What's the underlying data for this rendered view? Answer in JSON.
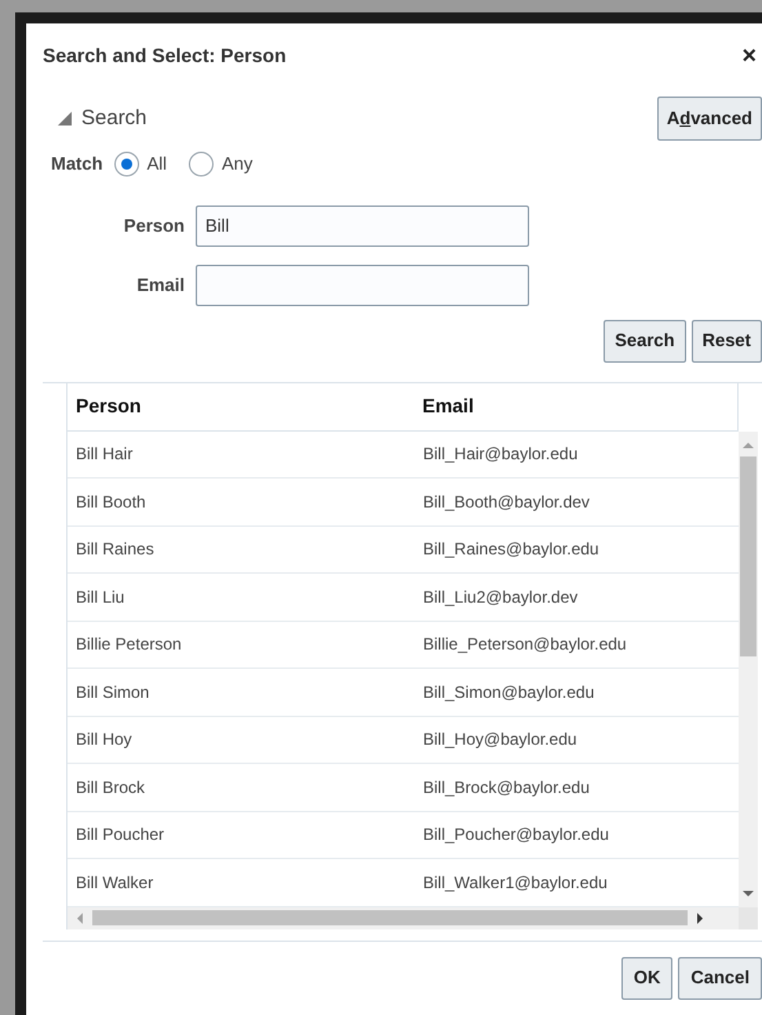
{
  "dialog": {
    "title": "Search and Select: Person",
    "close": "×"
  },
  "search": {
    "header": "Search",
    "expanded": true,
    "advanced": {
      "before": "A",
      "access_key": "d",
      "after": "vanced"
    },
    "match": {
      "label": "Match",
      "options": [
        {
          "label": "All",
          "selected": true
        },
        {
          "label": "Any",
          "selected": false
        }
      ]
    },
    "fields": [
      {
        "label": "Person",
        "value": "Bill"
      },
      {
        "label": "Email"
      }
    ],
    "buttons": [
      "Search",
      "Reset"
    ]
  },
  "table": {
    "columns": [
      "Person",
      "Email"
    ],
    "rows": [
      [
        "Bill Hair",
        "Bill_Hair@baylor.edu"
      ],
      [
        "Bill Booth",
        "Bill_Booth@baylor.dev"
      ],
      [
        "Bill Raines",
        "Bill_Raines@baylor.edu"
      ],
      [
        "Bill Liu",
        "Bill_Liu2@baylor.dev"
      ],
      [
        "Billie Peterson",
        "Billie_Peterson@baylor.edu"
      ],
      [
        "Bill Simon",
        "Bill_Simon@baylor.edu"
      ],
      [
        "Bill Hoy",
        "Bill_Hoy@baylor.edu"
      ],
      [
        "Bill Brock",
        "Bill_Brock@baylor.edu"
      ],
      [
        "Bill Poucher",
        "Bill_Poucher@baylor.edu"
      ],
      [
        "Bill Walker",
        "Bill_Walker1@baylor.edu"
      ]
    ]
  },
  "footer_buttons": [
    "OK",
    "Cancel"
  ]
}
